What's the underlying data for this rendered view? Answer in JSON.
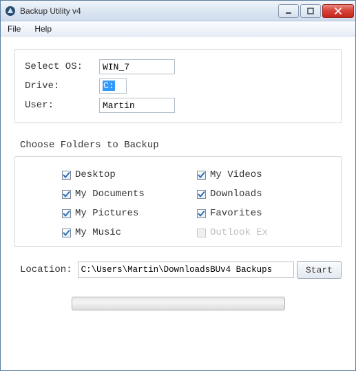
{
  "window": {
    "title": "Backup Utility v4"
  },
  "menu": {
    "file": "File",
    "help": "Help"
  },
  "form": {
    "os_label": "Select OS:",
    "os_value": "WIN_7",
    "drive_label": "Drive:",
    "drive_value": "C:",
    "user_label": "User:",
    "user_value": "Martin"
  },
  "folders_heading": "Choose Folders to Backup",
  "folders": [
    {
      "label": "Desktop",
      "checked": true,
      "enabled": true
    },
    {
      "label": "My Videos",
      "checked": true,
      "enabled": true
    },
    {
      "label": "My Documents",
      "checked": true,
      "enabled": true
    },
    {
      "label": "Downloads",
      "checked": true,
      "enabled": true
    },
    {
      "label": "My Pictures",
      "checked": true,
      "enabled": true
    },
    {
      "label": "Favorites",
      "checked": true,
      "enabled": true
    },
    {
      "label": "My Music",
      "checked": true,
      "enabled": true
    },
    {
      "label": "Outlook Ex",
      "checked": false,
      "enabled": false
    }
  ],
  "location": {
    "label": "Location:",
    "value": "C:\\Users\\Martin\\DownloadsBUv4 Backups"
  },
  "buttons": {
    "start": "Start"
  },
  "progress": {
    "value": 0,
    "max": 100
  }
}
